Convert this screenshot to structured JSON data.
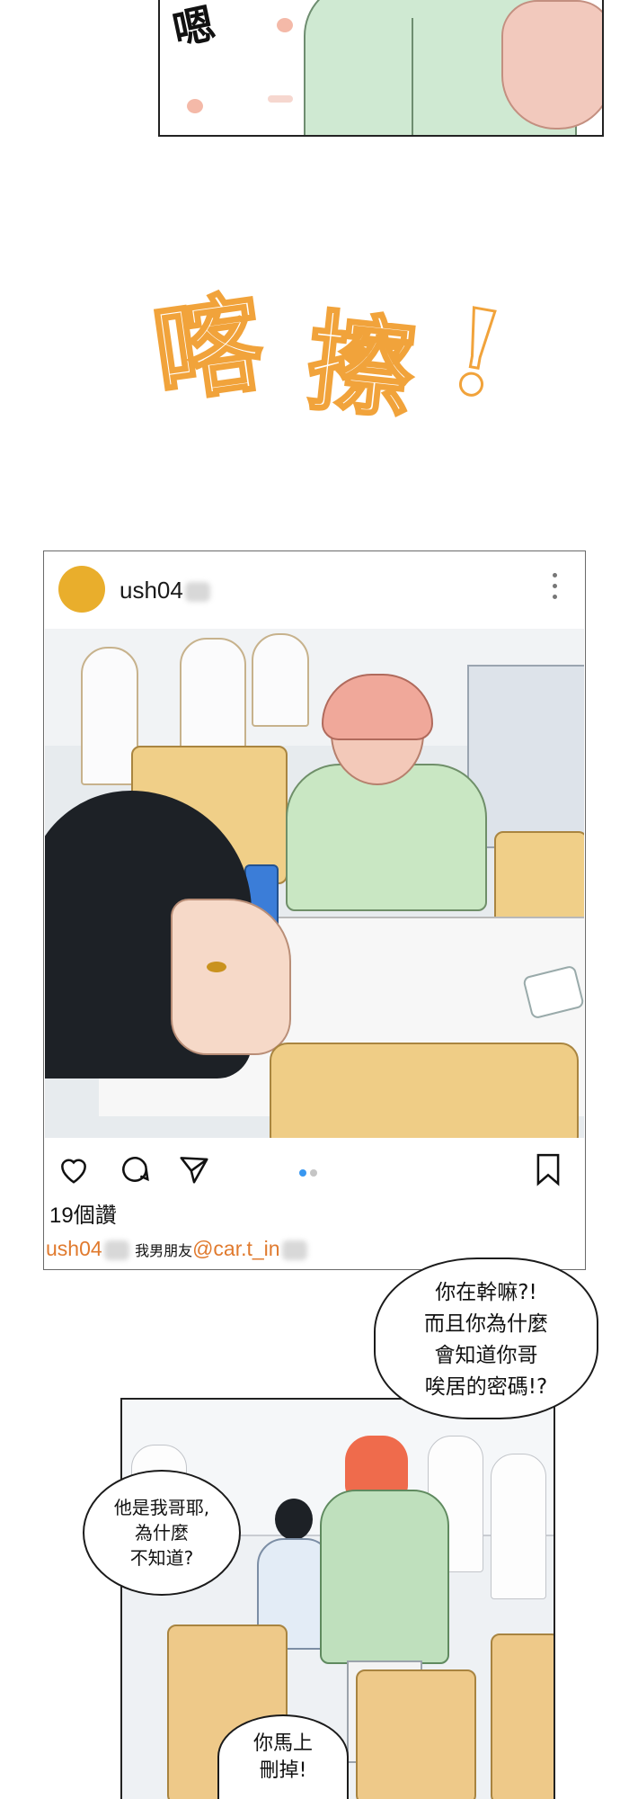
{
  "top_panel": {
    "sfx": "嗯"
  },
  "big_sfx": {
    "chars": [
      "喀",
      "擦",
      "!"
    ]
  },
  "post": {
    "username": "ush04",
    "likes": "19個讚",
    "caption_user": "ush04",
    "caption_text": "我男朋友",
    "caption_tag": "@car.t_in",
    "carousel_dots": 2,
    "carousel_active": 1
  },
  "bubbles": {
    "bubble1": [
      "你在幹嘛?!",
      "而且你為什麼",
      "會知道你哥",
      "唉居的密碼!?"
    ],
    "bubble2": [
      "他是我哥耶,",
      "為什麼",
      "不知道?"
    ],
    "bubble3": [
      "你馬上",
      "刪掉!"
    ]
  },
  "colors": {
    "sfx_orange": "#f1a33b",
    "avatar": "#e9ae2c",
    "caption_accent": "#e07a2e",
    "dot_active": "#3897f0"
  },
  "icons": [
    "heart-icon",
    "comment-icon",
    "share-icon",
    "bookmark-icon",
    "more-icon",
    "paw-icon"
  ]
}
